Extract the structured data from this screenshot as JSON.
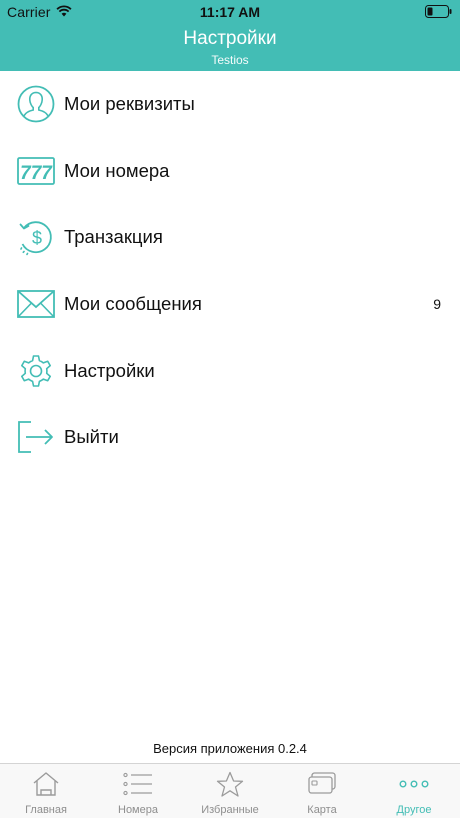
{
  "status_bar": {
    "carrier": "Carrier",
    "time": "11:17 AM"
  },
  "nav": {
    "title": "Настройки",
    "subtitle": "Testios"
  },
  "menu": {
    "items": [
      {
        "label": "Мои реквизиты",
        "icon": "user-avatar-icon"
      },
      {
        "label": "Мои номера",
        "icon": "number-777-icon"
      },
      {
        "label": "Транзакция",
        "icon": "dollar-cycle-icon"
      },
      {
        "label": "Мои сообщения",
        "icon": "envelope-icon",
        "badge": "9"
      },
      {
        "label": "Настройки",
        "icon": "gear-icon"
      },
      {
        "label": "Выйти",
        "icon": "logout-icon"
      }
    ]
  },
  "version_text": "Версия приложения 0.2.4",
  "tabbar": {
    "tabs": [
      {
        "label": "Главная",
        "icon": "home-icon"
      },
      {
        "label": "Номера",
        "icon": "list-icon"
      },
      {
        "label": "Избранные",
        "icon": "star-icon"
      },
      {
        "label": "Карта",
        "icon": "card-icon"
      },
      {
        "label": "Другое",
        "icon": "more-dots-icon",
        "active": true
      }
    ]
  },
  "colors": {
    "accent": "#43bdb5",
    "tab_inactive": "#8e8e8e"
  }
}
